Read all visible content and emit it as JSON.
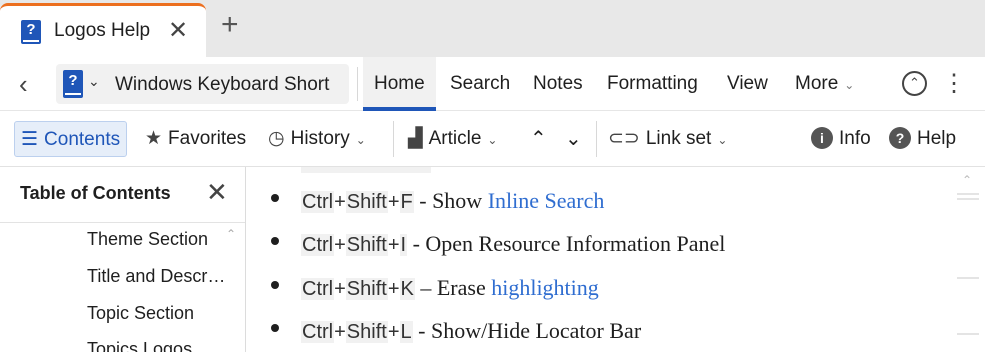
{
  "tab": {
    "icon": "help-book-icon",
    "title": "Logos Help",
    "close": "✕",
    "new_tab": "+"
  },
  "nav": {
    "back": "‹",
    "resource_title": "Windows Keyboard Short",
    "menu": [
      {
        "label": "Home",
        "active": true
      },
      {
        "label": "Search"
      },
      {
        "label": "Notes"
      },
      {
        "label": "Formatting"
      },
      {
        "label": "View"
      },
      {
        "label": "More"
      }
    ]
  },
  "toolbar": {
    "contents": "Contents",
    "favorites": "Favorites",
    "history": "History",
    "article": "Article",
    "link_set": "Link set",
    "info": "Info",
    "help": "Help"
  },
  "sidebar": {
    "title": "Table of Contents",
    "items": [
      "Theme Section",
      "Title and Description",
      "Topic Section",
      "Topics Logos"
    ]
  },
  "content": {
    "items": [
      {
        "keys": [
          "Ctrl",
          "Shift",
          "F"
        ],
        "sep": " - ",
        "text": "Show ",
        "link": "Inline Search",
        "after": ""
      },
      {
        "keys": [
          "Ctrl",
          "Shift",
          "I"
        ],
        "sep": " - ",
        "text": "Open Resource Information Panel",
        "link": "",
        "after": ""
      },
      {
        "keys": [
          "Ctrl",
          "Shift",
          "K"
        ],
        "sep": " – ",
        "text": "Erase ",
        "link": "highlighting",
        "after": ""
      },
      {
        "keys": [
          "Ctrl",
          "Shift",
          "L"
        ],
        "sep": " - ",
        "text": "Show/Hide Locator Bar",
        "link": "",
        "after": ""
      }
    ]
  },
  "colors": {
    "accent": "#1f56b8",
    "tab_highlight": "#ec6f1f",
    "link": "#2f6dd0"
  }
}
